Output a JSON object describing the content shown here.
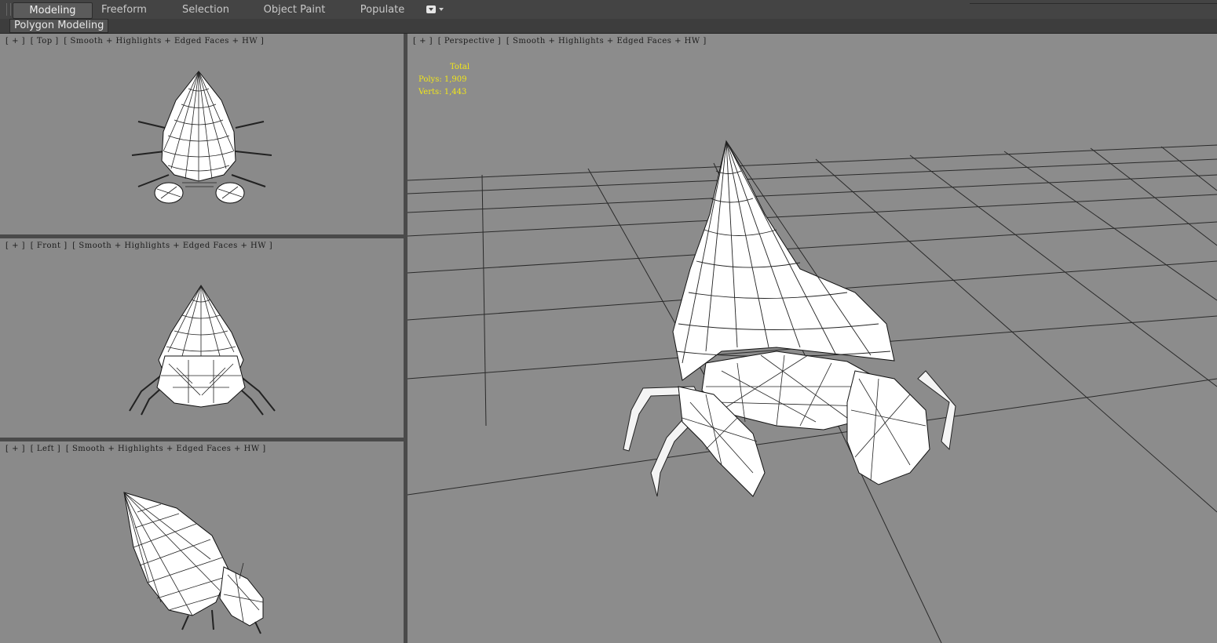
{
  "ribbon": {
    "tabs": [
      {
        "label": "Modeling",
        "active": true
      },
      {
        "label": "Freeform",
        "active": false
      },
      {
        "label": "Selection",
        "active": false
      },
      {
        "label": "Object Paint",
        "active": false
      },
      {
        "label": "Populate",
        "active": false
      }
    ],
    "dropdown_icon": "ribbon-options-icon"
  },
  "panel": {
    "label": "Polygon Modeling"
  },
  "viewports": {
    "top": {
      "plus": "[ + ]",
      "name": "[ Top ]",
      "shading": "[ Smooth + Highlights + Edged Faces + HW ]"
    },
    "front": {
      "plus": "[ + ]",
      "name": "[ Front ]",
      "shading": "[ Smooth + Highlights + Edged Faces + HW ]"
    },
    "left": {
      "plus": "[ + ]",
      "name": "[ Left ]",
      "shading": "[ Smooth + Highlights + Edged Faces + HW ]"
    },
    "perspective": {
      "plus": "[ + ]",
      "name": "[ Perspective ]",
      "shading": "[ Smooth + Highlights + Edged Faces + HW ]"
    }
  },
  "stats": {
    "title": "Total",
    "polys_label": "Polys:",
    "polys_value": "1,909",
    "verts_label": "Verts:",
    "verts_value": "1,443"
  },
  "colors": {
    "viewport_bg": "#8a8a8a",
    "stats_text": "#f1e61a",
    "ui_bg": "#3a3a3a"
  }
}
